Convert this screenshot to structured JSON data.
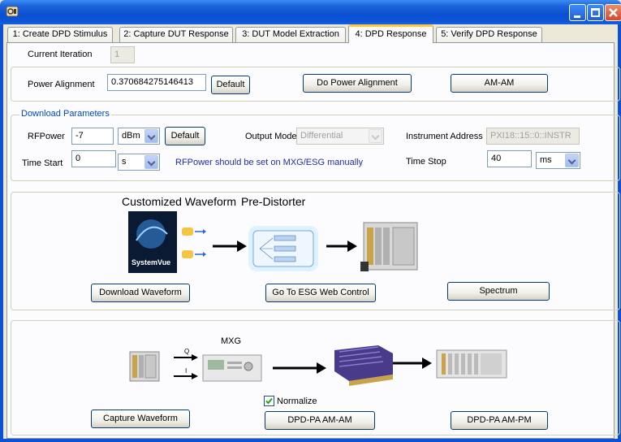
{
  "window": {
    "app_icon": "app-icon"
  },
  "tabs": [
    {
      "label": "1: Create DPD Stimulus"
    },
    {
      "label": "2: Capture DUT Response"
    },
    {
      "label": "3: DUT Model Extraction"
    },
    {
      "label": "4: DPD Response"
    },
    {
      "label": "5: Verify DPD Response"
    }
  ],
  "iteration": {
    "label": "Current Iteration",
    "value": "1"
  },
  "power": {
    "label": "Power Alignment",
    "value": "0.370684275146413",
    "default_label": "Default",
    "align_label": "Do Power Alignment",
    "amam_label": "AM-AM"
  },
  "download": {
    "title": "Download Parameters",
    "rfpower_label": "RFPower",
    "rfpower_value": "-7",
    "rfpower_unit": "dBm",
    "default_label": "Default",
    "output_mode_label": "Output Mode",
    "output_mode_value": "Differential",
    "instrument_label": "Instrument Address",
    "instrument_value": "PXI18::15::0::INSTR",
    "time_start_label": "Time Start",
    "time_start_value": "0",
    "time_start_unit": "s",
    "note": "RFPower should be set on MXG/ESG manually",
    "time_stop_label": "Time Stop",
    "time_stop_value": "40",
    "time_stop_unit": "ms"
  },
  "waveform": {
    "customized_label": "Customized Waveform",
    "predistorter_label": "Pre-Distorter",
    "logo_text": "SystemVue",
    "download_btn": "Download Waveform",
    "esg_btn": "Go To ESG Web Control",
    "spectrum_btn": "Spectrum"
  },
  "capture": {
    "mxg_label": "MXG",
    "q_label": "Q",
    "i_label": "I",
    "normalize_label": "Normalize",
    "normalize_checked": true,
    "capture_btn": "Capture Waveform",
    "amam_btn": "DPD-PA AM-AM",
    "ampm_btn": "DPD-PA AM-PM"
  }
}
